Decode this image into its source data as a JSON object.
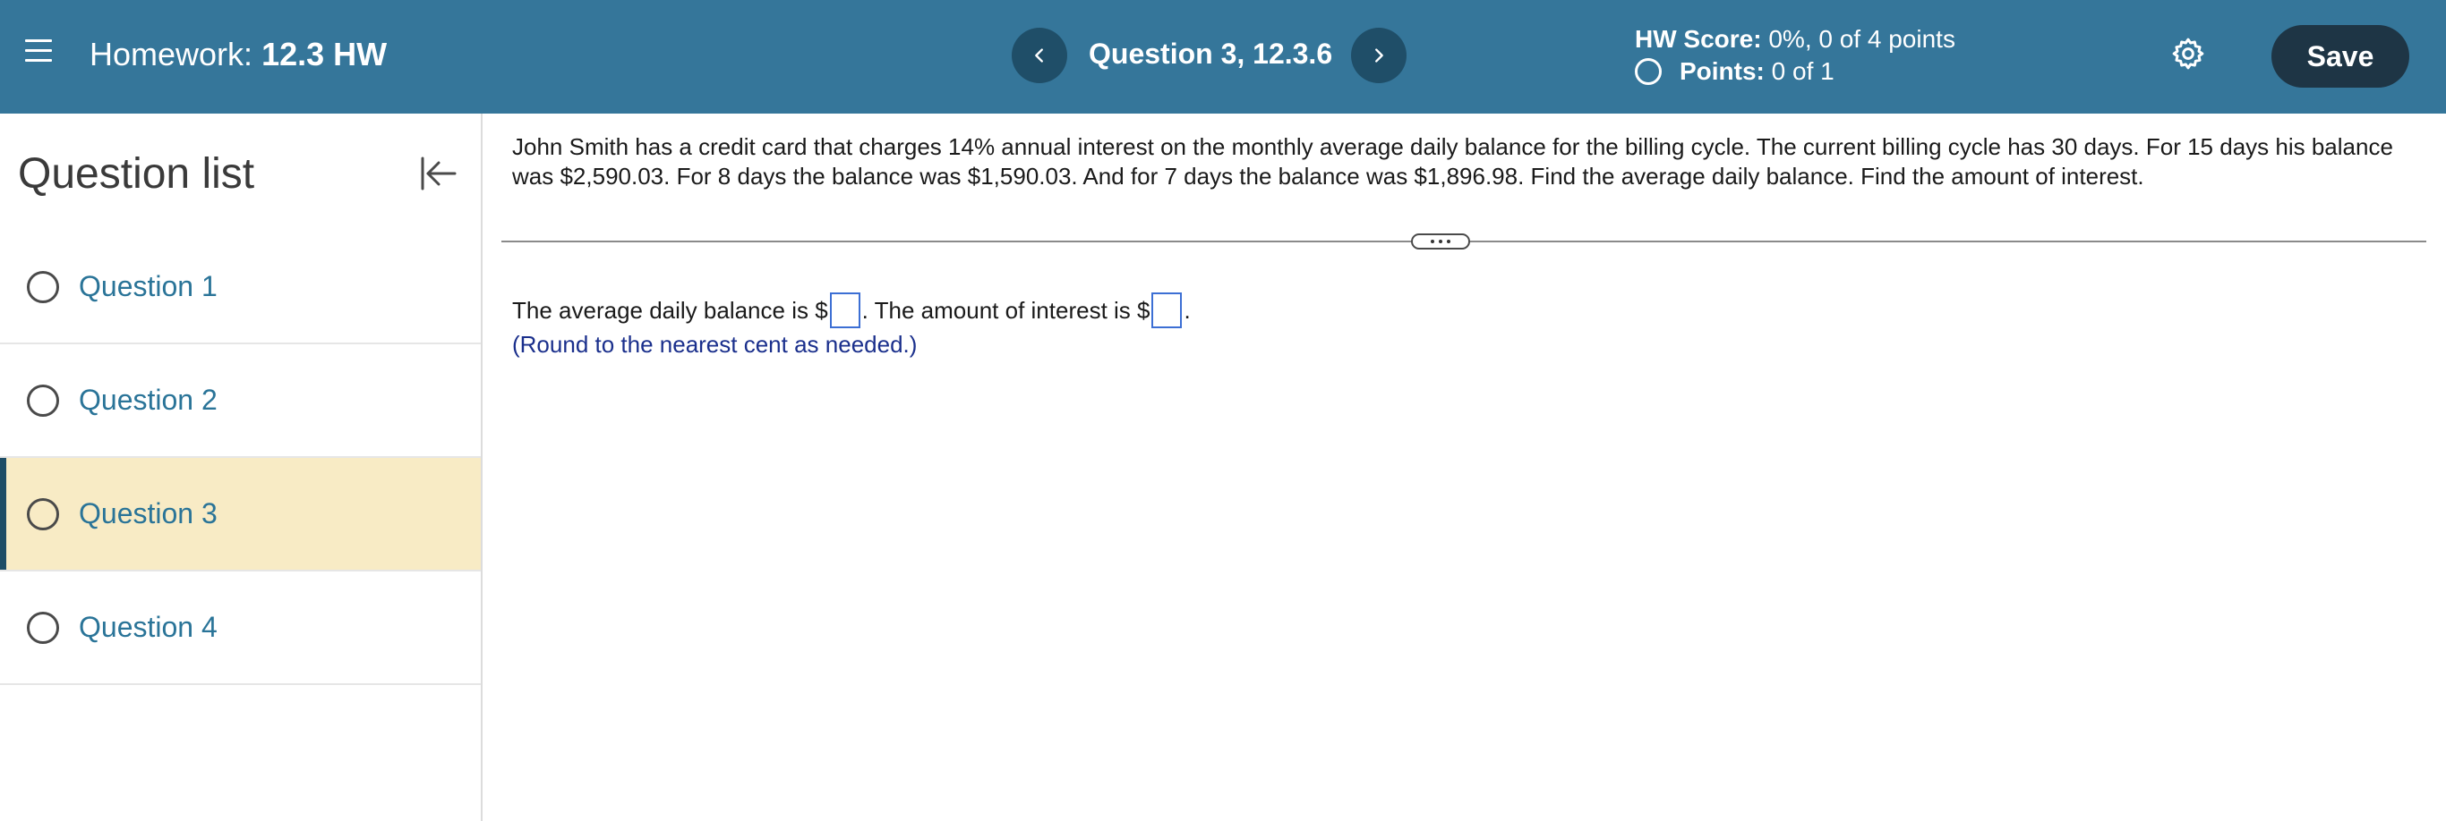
{
  "header": {
    "homework_prefix": "Homework:",
    "homework_name": "12.3 HW",
    "question_title": "Question 3, 12.3.6",
    "hw_score_label": "HW Score:",
    "hw_score_value": "0%, 0 of 4 points",
    "points_label": "Points:",
    "points_value": "0 of 1",
    "save_label": "Save"
  },
  "sidebar": {
    "title": "Question list",
    "items": [
      {
        "label": "Question 1"
      },
      {
        "label": "Question 2"
      },
      {
        "label": "Question 3"
      },
      {
        "label": "Question 4"
      }
    ]
  },
  "main": {
    "prompt": "John Smith has a credit card that charges 14% annual interest on the monthly average daily balance for the billing cycle. The current billing cycle has 30 days. For 15 days his balance was $2,590.03. For 8 days the balance was $1,590.03. And for 7 days the balance was $1,896.98. Find the average daily balance. Find the amount of interest.",
    "answer_part1": "The average daily balance is $",
    "answer_part2": ". The amount of interest is $",
    "answer_part3": ".",
    "hint": "(Round to the nearest cent as needed.)"
  },
  "colors": {
    "header_bg": "#35769a",
    "save_bg": "#1e3545",
    "active_item_bg": "#f8ebc5",
    "link": "#2a7498"
  },
  "icons": [
    "hamburger-menu-icon",
    "chevron-left-icon",
    "chevron-right-icon",
    "gear-icon",
    "collapse-left-icon",
    "more-dots-icon"
  ]
}
